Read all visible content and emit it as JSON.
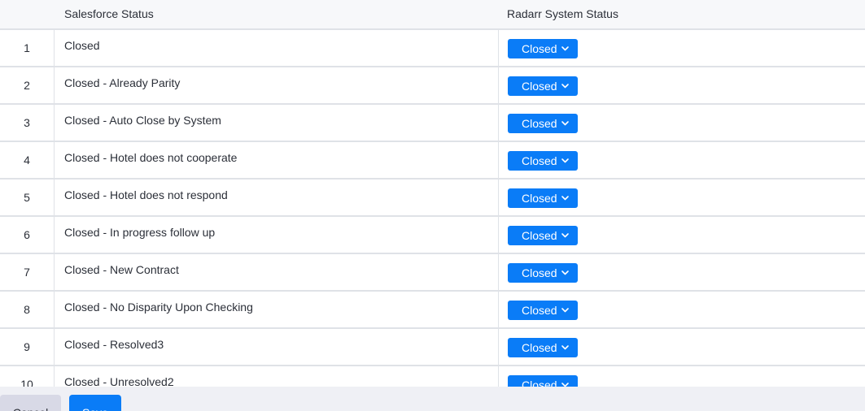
{
  "table": {
    "headers": {
      "number": "",
      "salesforce_status": "Salesforce Status",
      "radarr_status": "Radarr System Status"
    },
    "rows": [
      {
        "num": "1",
        "salesforce": "Closed",
        "radarr": "Closed"
      },
      {
        "num": "2",
        "salesforce": "Closed - Already Parity",
        "radarr": "Closed"
      },
      {
        "num": "3",
        "salesforce": "Closed - Auto Close by System",
        "radarr": "Closed"
      },
      {
        "num": "4",
        "salesforce": "Closed - Hotel does not cooperate",
        "radarr": "Closed"
      },
      {
        "num": "5",
        "salesforce": "Closed - Hotel does not respond",
        "radarr": "Closed"
      },
      {
        "num": "6",
        "salesforce": "Closed - In progress follow up",
        "radarr": "Closed"
      },
      {
        "num": "7",
        "salesforce": "Closed - New Contract",
        "radarr": "Closed"
      },
      {
        "num": "8",
        "salesforce": "Closed - No Disparity Upon Checking",
        "radarr": "Closed"
      },
      {
        "num": "9",
        "salesforce": "Closed - Resolved3",
        "radarr": "Closed"
      },
      {
        "num": "10",
        "salesforce": "Closed - Unresolved2",
        "radarr": "Closed"
      }
    ]
  },
  "footer": {
    "cancel_label": "Cancel",
    "save_label": "Save"
  },
  "colors": {
    "accent": "#0a7cf7",
    "cancel_bg": "#d8d9e6",
    "header_bg": "#f7f8fa",
    "footer_bg": "#eff0f5",
    "divider": "#dfe2e7"
  },
  "icons": {
    "dropdown": "chevron-down-icon"
  }
}
